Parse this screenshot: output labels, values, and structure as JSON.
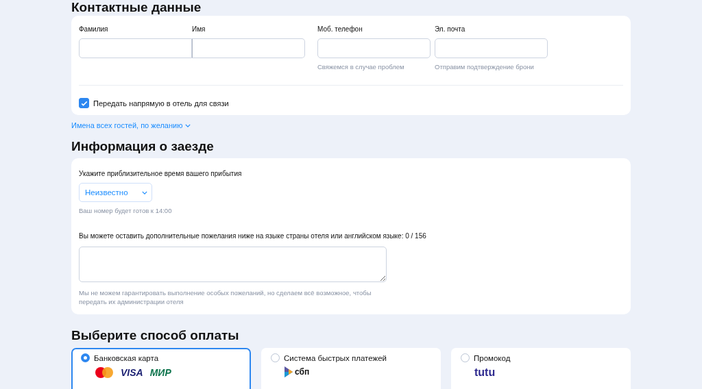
{
  "contacts": {
    "title": "Контактные данные",
    "fields": [
      {
        "label": "Фамилия",
        "joined": true
      },
      {
        "label": "Имя",
        "joined": true
      },
      {
        "label": "Моб. телефон",
        "hint": "Свяжемся в случае проблем"
      },
      {
        "label": "Эл. почта",
        "hint": "Отправим подтверждение брони"
      }
    ],
    "direct": {
      "label": "Передать напрямую в отель для связи",
      "checked": true
    }
  },
  "guests_link": "Имена всех гостей, по желанию",
  "checkin": {
    "title": "Информация о заезде",
    "arrival_label": "Укажите приблизительное время вашего прибытия",
    "arrival_value": "Неизвестно",
    "arrival_hint": "Ваш номер будет готов к 14:00",
    "wishes_label": "Вы можете оставить дополнительные пожелания ниже на языке страны отеля или английском языке: 0 / 156",
    "wishes_hint": "Мы не можем гарантировать выполнение особых пожеланий, но сделаем всё возможное, чтобы передать их администрации отеля"
  },
  "payment": {
    "title": "Выберите способ оплаты",
    "options": [
      {
        "label": "Банковская карта",
        "selected": true,
        "logos": [
          {
            "kind": "mastercard"
          },
          {
            "kind": "visa",
            "text": "VISA"
          },
          {
            "kind": "mir",
            "text": "МИР"
          }
        ]
      },
      {
        "label": "Система быстрых платежей",
        "selected": false,
        "logos": [
          {
            "kind": "sbp",
            "text": "сбп"
          }
        ]
      },
      {
        "label": "Промокод",
        "selected": false,
        "logos": [
          {
            "kind": "tutu",
            "text": "tutu"
          }
        ]
      }
    ]
  }
}
